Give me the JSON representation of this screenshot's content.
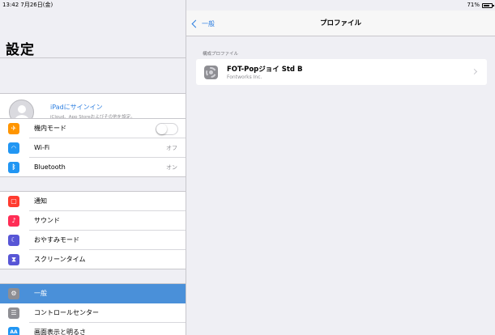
{
  "status": {
    "time": "13:42  7月26日(金)",
    "battery": "71%"
  },
  "sidebar": {
    "title": "設定",
    "signin": {
      "title": "iPadにサインイン",
      "subtitle": "iCloud、App Storeおよびその他を設定。"
    },
    "airplane": {
      "label": "機内モード",
      "icon": "airplane-icon",
      "color": "#ff9500",
      "on": false
    },
    "wifi": {
      "label": "Wi-Fi",
      "value": "オフ",
      "icon": "wifi-icon",
      "color": "#2196f3"
    },
    "bluetooth": {
      "label": "Bluetooth",
      "value": "オン",
      "icon": "bluetooth-icon",
      "color": "#2196f3"
    },
    "notifications": {
      "label": "通知",
      "icon": "notification-icon",
      "color": "#ff3b30"
    },
    "sounds": {
      "label": "サウンド",
      "icon": "speaker-icon",
      "color": "#ff2d55"
    },
    "dnd": {
      "label": "おやすみモード",
      "icon": "moon-icon",
      "color": "#5856d6"
    },
    "screentime": {
      "label": "スクリーンタイム",
      "icon": "hourglass-icon",
      "color": "#5856d6"
    },
    "general": {
      "label": "一般",
      "icon": "gear-icon",
      "color": "#8e8e93",
      "selected": true
    },
    "control_center": {
      "label": "コントロールセンター",
      "icon": "switches-icon",
      "color": "#8e8e93"
    },
    "display": {
      "label": "画面表示と明るさ",
      "icon": "aa-icon",
      "color": "#2196f3"
    }
  },
  "detail": {
    "back_label": "一般",
    "title": "プロファイル",
    "section_header": "構成プロファイル",
    "profile": {
      "name": "FOT-Popジョイ Std B",
      "org": "Fontworks Inc."
    }
  }
}
